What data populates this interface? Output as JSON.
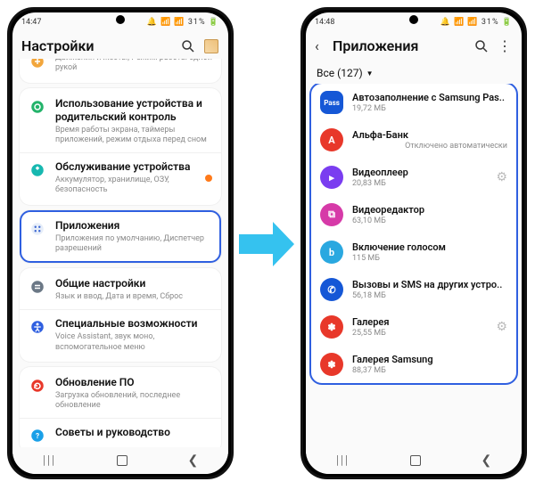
{
  "status": {
    "time_left": "14:47",
    "time_right": "14:48",
    "icons_left": "⬛ ✉ ※ ⟳",
    "icons_right": "🔔 📶 📶 31% 🔋"
  },
  "left": {
    "title": "Настройки",
    "groups": [
      {
        "rows": [
          {
            "icon": "motion",
            "title": "",
            "sub": "Движения и жесты, Режим работы одной рукой"
          }
        ]
      },
      {
        "rows": [
          {
            "icon": "care",
            "title": "Использование устройства и родительский контроль",
            "sub": "Время работы экрана, таймеры приложений, режим отдыха перед сном"
          },
          {
            "icon": "maint",
            "title": "Обслуживание устройства",
            "sub": "Аккумулятор, хранилище, ОЗУ, безопасность",
            "badge": true
          }
        ]
      },
      {
        "highlight": true,
        "rows": [
          {
            "icon": "apps",
            "title": "Приложения",
            "sub": "Приложения по умолчанию, Диспетчер разрешений"
          }
        ]
      },
      {
        "rows": [
          {
            "icon": "general",
            "title": "Общие настройки",
            "sub": "Язык и ввод, Дата и время, Сброс"
          },
          {
            "icon": "access",
            "title": "Специальные возможности",
            "sub": "Voice Assistant, звук моно, вспомогательное меню"
          }
        ]
      },
      {
        "rows": [
          {
            "icon": "update",
            "title": "Обновление ПО",
            "sub": "Загрузка обновлений, последнее обновление"
          },
          {
            "icon": "tips",
            "title": "Советы и руководство",
            "sub": ""
          }
        ]
      }
    ]
  },
  "right": {
    "title": "Приложения",
    "filter": "Все (127)",
    "apps": [
      {
        "name": "Автозаполнение с Samsung Pas..",
        "sub": "19,72 МБ",
        "color": "#1557d6",
        "glyph": "Pass"
      },
      {
        "name": "Альфа-Банк",
        "sub": "Отключено автоматически",
        "color": "#e8382a",
        "glyph": "А",
        "sub_right": true
      },
      {
        "name": "Видеоплеер",
        "sub": "20,83 МБ",
        "color": "#7a3df0",
        "glyph": "▸",
        "gear": true
      },
      {
        "name": "Видеоредактор",
        "sub": "63,10 МБ",
        "color": "#d63aa8",
        "glyph": "⧉"
      },
      {
        "name": "Включение голосом",
        "sub": "115 МБ",
        "color": "#2aa8e0",
        "glyph": "b"
      },
      {
        "name": "Вызовы и SMS на других устро..",
        "sub": "56,18 МБ",
        "color": "#1557d6",
        "glyph": "✆"
      },
      {
        "name": "Галерея",
        "sub": "25,55 МБ",
        "color": "#e8382a",
        "glyph": "✽",
        "gear": true
      },
      {
        "name": "Галерея Samsung",
        "sub": "88,37 МБ",
        "color": "#e8382a",
        "glyph": "✽"
      }
    ]
  },
  "nav": {
    "recent": "|||",
    "home": "",
    "back": "❮"
  }
}
